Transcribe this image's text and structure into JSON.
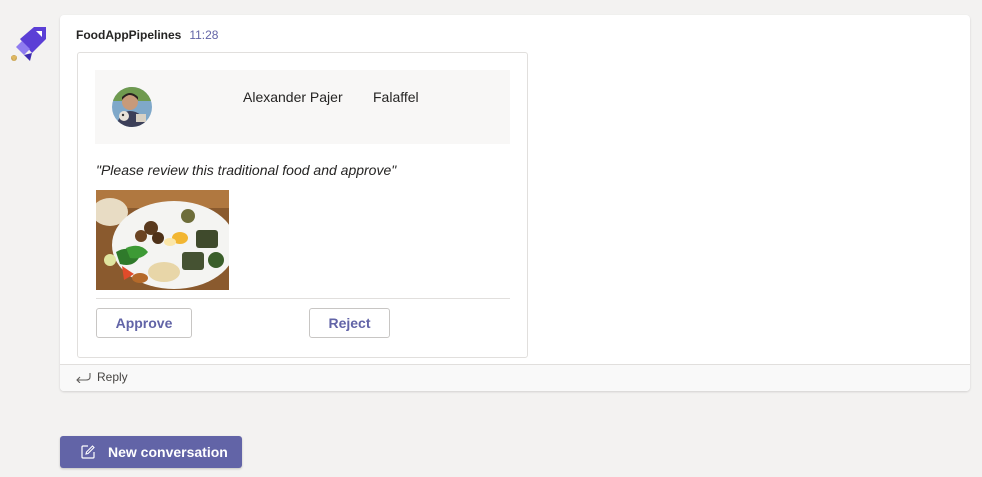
{
  "post": {
    "sender": "FoodAppPipelines",
    "time": "11:28"
  },
  "card": {
    "user_name": "Alexander Pajer",
    "food_name": "Falaffel",
    "quote": "\"Please review this traditional food and approve\"",
    "actions": {
      "approve": "Approve",
      "reject": "Reject"
    }
  },
  "reply": {
    "label": "Reply"
  },
  "compose": {
    "new_conversation": "New conversation"
  },
  "icons": {
    "bot": "azure-pipelines-icon",
    "reply": "reply-arrow-icon",
    "compose": "compose-icon"
  },
  "colors": {
    "accent": "#6264a7",
    "background": "#f3f2f1",
    "card_header": "#f8f7f6"
  }
}
